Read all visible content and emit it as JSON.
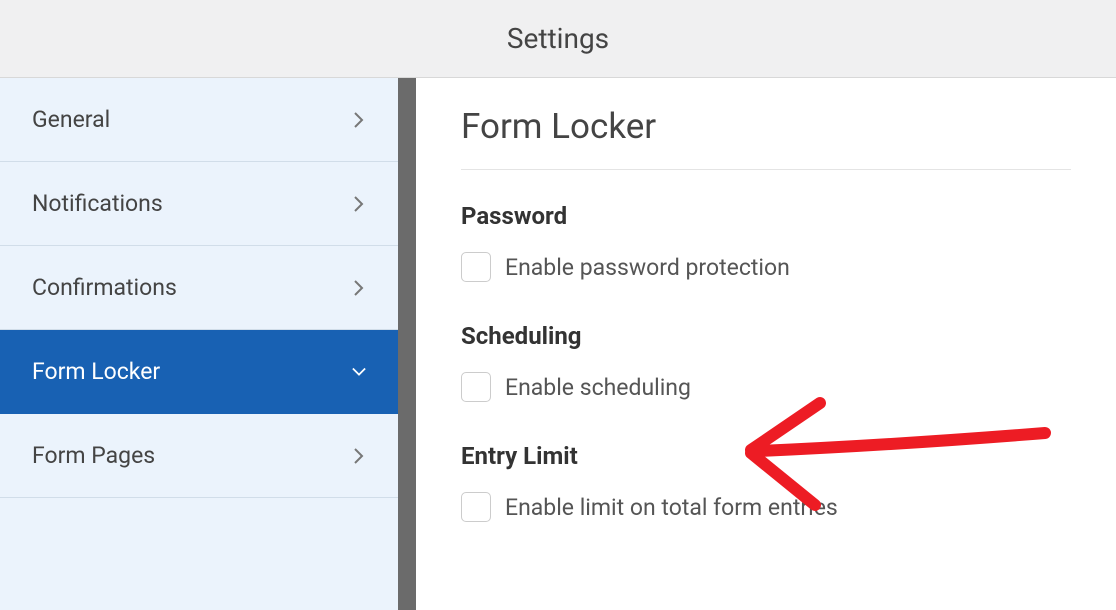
{
  "header": {
    "title": "Settings"
  },
  "sidebar": {
    "items": [
      {
        "label": "General",
        "active": false
      },
      {
        "label": "Notifications",
        "active": false
      },
      {
        "label": "Confirmations",
        "active": false
      },
      {
        "label": "Form Locker",
        "active": true
      },
      {
        "label": "Form Pages",
        "active": false
      }
    ]
  },
  "content": {
    "title": "Form Locker",
    "sections": {
      "password": {
        "header": "Password",
        "checkbox_label": "Enable password protection"
      },
      "scheduling": {
        "header": "Scheduling",
        "checkbox_label": "Enable scheduling"
      },
      "entry_limit": {
        "header": "Entry Limit",
        "checkbox_label": "Enable limit on total form entries"
      }
    }
  },
  "annotation": {
    "color": "#ed1c24"
  }
}
